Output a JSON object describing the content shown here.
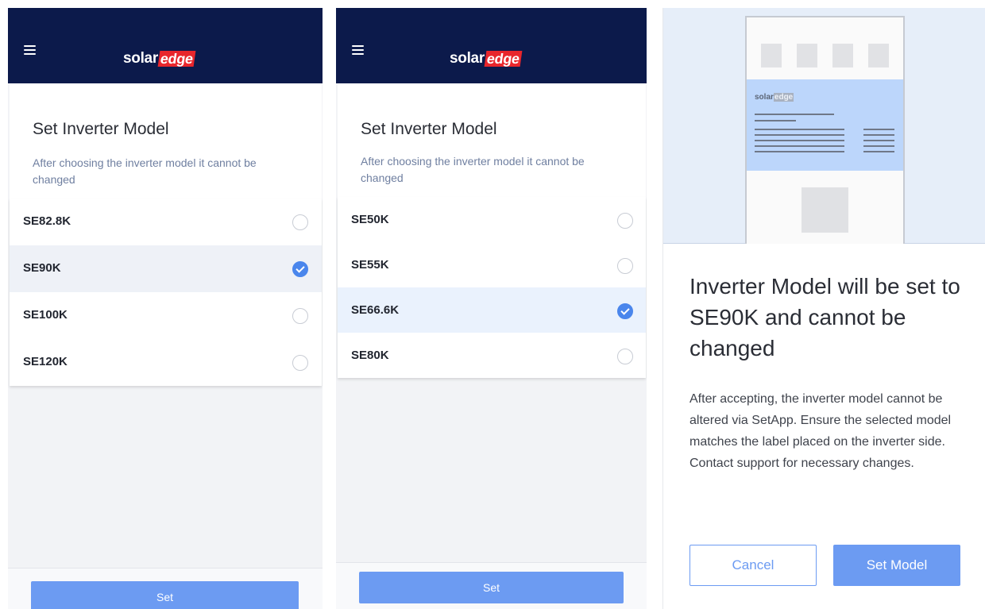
{
  "brand": {
    "word": "solar",
    "accent": "edge",
    "accent_color": "#e8262c",
    "header_color": "#0c1a4b"
  },
  "icons": {
    "menu": "hamburger-menu-icon",
    "check": "check-icon"
  },
  "screen1": {
    "title": "Set Inverter Model",
    "subtitle": "After choosing the inverter model it cannot be changed",
    "options": [
      {
        "label": "SE82.8K",
        "selected": false
      },
      {
        "label": "SE90K",
        "selected": true
      },
      {
        "label": "SE100K",
        "selected": false
      },
      {
        "label": "SE120K",
        "selected": false
      }
    ],
    "button_label": "Set"
  },
  "screen2": {
    "title": "Set Inverter Model",
    "subtitle": "After choosing the inverter model it cannot be changed",
    "options": [
      {
        "label": "SE50K",
        "selected": false
      },
      {
        "label": "SE55K",
        "selected": false
      },
      {
        "label": "SE66.6K",
        "selected": true
      },
      {
        "label": "SE80K",
        "selected": false
      }
    ],
    "button_label": "Set"
  },
  "dialog": {
    "illustration_logo_word": "solar",
    "illustration_logo_accent": "edge",
    "title": "Inverter Model will be set to SE90K and cannot be changed",
    "body": "After accepting, the inverter model cannot be altered via SetApp. Ensure the selected model matches the label placed on the inverter side. Contact support for necessary changes.",
    "cancel_label": "Cancel",
    "confirm_label": "Set Model",
    "accent_color": "#6c9bf2"
  }
}
